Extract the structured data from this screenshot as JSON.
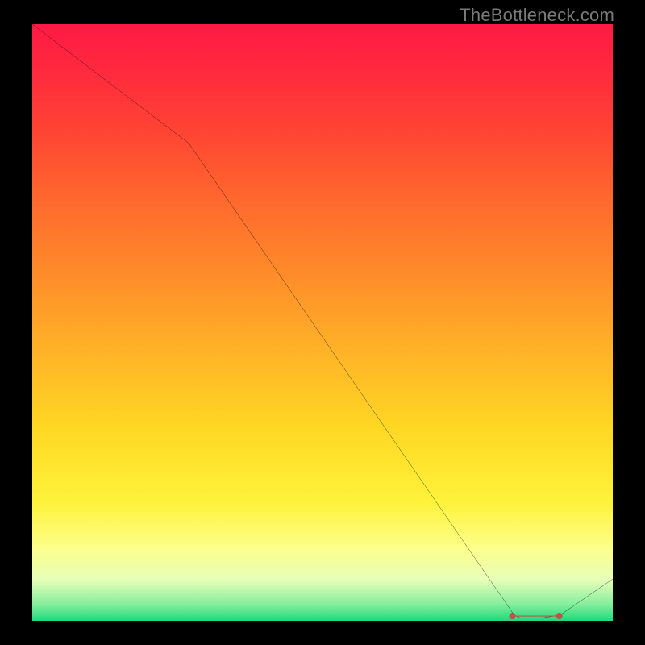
{
  "watermark": "TheBottleneck.com",
  "chart_data": {
    "type": "line",
    "title": "",
    "xlabel": "",
    "ylabel": "",
    "x": [
      0,
      27,
      83,
      84,
      88,
      91,
      100
    ],
    "values": [
      100,
      80,
      1,
      0.5,
      0.5,
      1,
      7
    ],
    "xlim": [
      0,
      100
    ],
    "ylim": [
      0,
      100
    ],
    "background_gradient": {
      "orientation": "vertical",
      "stops": [
        {
          "pos": 0.0,
          "color": "#ff1a44"
        },
        {
          "pos": 0.3,
          "color": "#ff6a2d"
        },
        {
          "pos": 0.68,
          "color": "#ffd824"
        },
        {
          "pos": 0.88,
          "color": "#fcff8c"
        },
        {
          "pos": 1.0,
          "color": "#1fd97c"
        }
      ]
    },
    "line_color": "#000000",
    "marker_segment": {
      "x_range": [
        83,
        91
      ],
      "color": "#b9433f",
      "style": "dotted"
    }
  }
}
